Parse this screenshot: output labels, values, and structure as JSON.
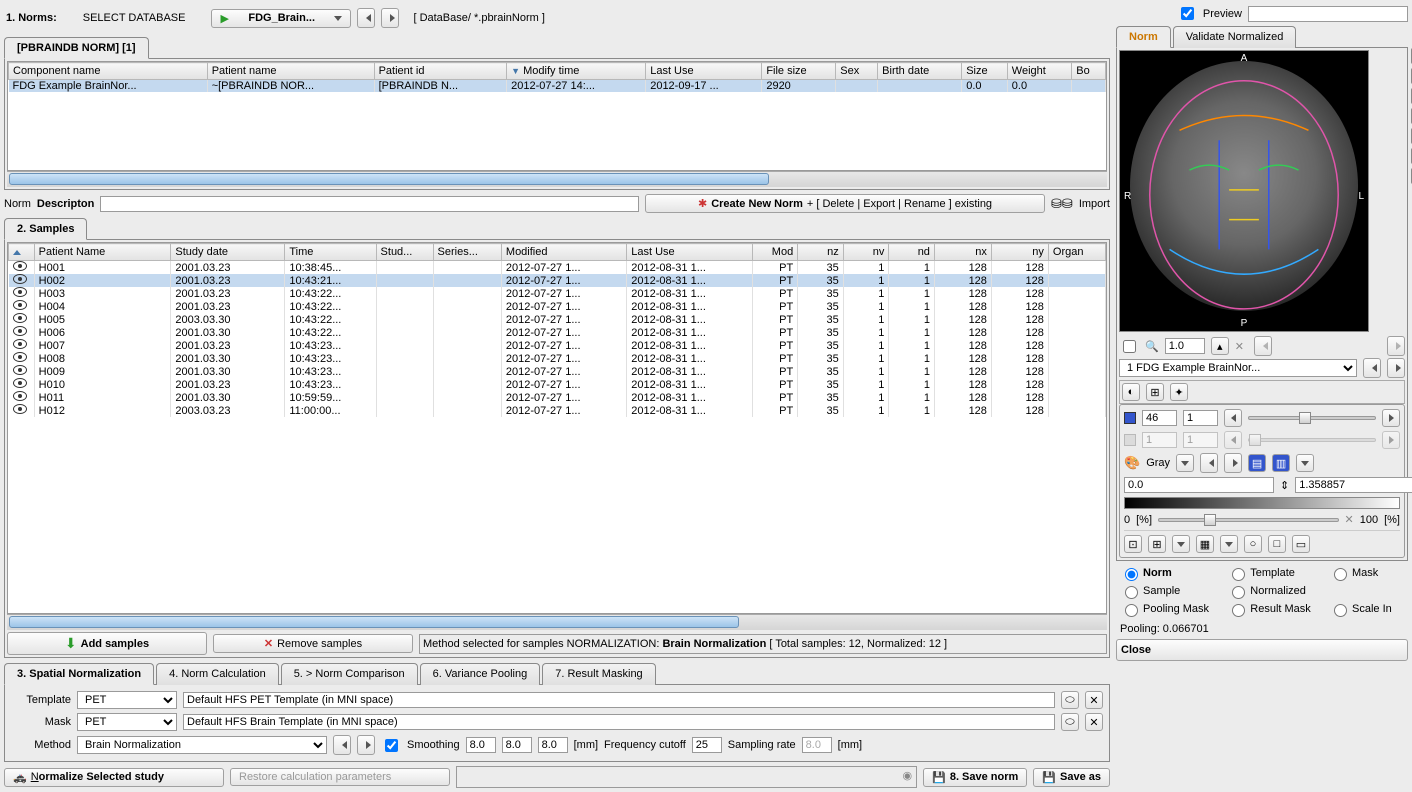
{
  "top": {
    "title": "1. Norms:",
    "selectDb": "SELECT DATABASE",
    "dbDropdown": "FDG_Brain...",
    "dbPath": "[  DataBase/ *.pbrainNorm  ]"
  },
  "normTable": {
    "tab": "[PBRAINDB NORM] [1]",
    "headers": [
      "Component name",
      "Patient name",
      "Patient id",
      "Modify time",
      "Last Use",
      "File size",
      "Sex",
      "Birth date",
      "Size",
      "Weight",
      "Bo"
    ],
    "row": [
      "FDG Example BrainNor...",
      "~[PBRAINDB NOR...",
      "[PBRAINDB N...",
      "2012-07-27 14:...",
      "2012-09-17 ...",
      "2920",
      "",
      "",
      "0.0",
      "0.0",
      ""
    ]
  },
  "normDesc": {
    "label": "Norm Descripton",
    "createBtn": "Create New Norm",
    "createSuffix": "+ [ Delete | Export | Rename ] existing",
    "importLabel": "Import"
  },
  "samplesTab": "2. Samples",
  "samplesTable": {
    "headers": [
      "Patient Name",
      "Study date",
      "Time",
      "Stud...",
      "Series...",
      "Modified",
      "Last Use",
      "Mod",
      "nz",
      "nv",
      "nd",
      "nx",
      "ny",
      "Organ"
    ],
    "rows": [
      {
        "name": "H001",
        "date": "2001.03.23",
        "time": "10:38:45...",
        "mod": "2012-07-27 1...",
        "last": "2012-08-31 1...",
        "modality": "PT",
        "nz": "35",
        "nv": "1",
        "nd": "1",
        "nx": "128",
        "ny": "128"
      },
      {
        "name": "H002",
        "date": "2001.03.23",
        "time": "10:43:21...",
        "mod": "2012-07-27 1...",
        "last": "2012-08-31 1...",
        "modality": "PT",
        "nz": "35",
        "nv": "1",
        "nd": "1",
        "nx": "128",
        "ny": "128",
        "selected": true
      },
      {
        "name": "H003",
        "date": "2001.03.23",
        "time": "10:43:22...",
        "mod": "2012-07-27 1...",
        "last": "2012-08-31 1...",
        "modality": "PT",
        "nz": "35",
        "nv": "1",
        "nd": "1",
        "nx": "128",
        "ny": "128"
      },
      {
        "name": "H004",
        "date": "2001.03.23",
        "time": "10:43:22...",
        "mod": "2012-07-27 1...",
        "last": "2012-08-31 1...",
        "modality": "PT",
        "nz": "35",
        "nv": "1",
        "nd": "1",
        "nx": "128",
        "ny": "128"
      },
      {
        "name": "H005",
        "date": "2003.03.30",
        "time": "10:43:22...",
        "mod": "2012-07-27 1...",
        "last": "2012-08-31 1...",
        "modality": "PT",
        "nz": "35",
        "nv": "1",
        "nd": "1",
        "nx": "128",
        "ny": "128"
      },
      {
        "name": "H006",
        "date": "2001.03.30",
        "time": "10:43:22...",
        "mod": "2012-07-27 1...",
        "last": "2012-08-31 1...",
        "modality": "PT",
        "nz": "35",
        "nv": "1",
        "nd": "1",
        "nx": "128",
        "ny": "128"
      },
      {
        "name": "H007",
        "date": "2001.03.23",
        "time": "10:43:23...",
        "mod": "2012-07-27 1...",
        "last": "2012-08-31 1...",
        "modality": "PT",
        "nz": "35",
        "nv": "1",
        "nd": "1",
        "nx": "128",
        "ny": "128"
      },
      {
        "name": "H008",
        "date": "2001.03.30",
        "time": "10:43:23...",
        "mod": "2012-07-27 1...",
        "last": "2012-08-31 1...",
        "modality": "PT",
        "nz": "35",
        "nv": "1",
        "nd": "1",
        "nx": "128",
        "ny": "128"
      },
      {
        "name": "H009",
        "date": "2001.03.30",
        "time": "10:43:23...",
        "mod": "2012-07-27 1...",
        "last": "2012-08-31 1...",
        "modality": "PT",
        "nz": "35",
        "nv": "1",
        "nd": "1",
        "nx": "128",
        "ny": "128"
      },
      {
        "name": "H010",
        "date": "2001.03.23",
        "time": "10:43:23...",
        "mod": "2012-07-27 1...",
        "last": "2012-08-31 1...",
        "modality": "PT",
        "nz": "35",
        "nv": "1",
        "nd": "1",
        "nx": "128",
        "ny": "128"
      },
      {
        "name": "H011",
        "date": "2001.03.30",
        "time": "10:59:59...",
        "mod": "2012-07-27 1...",
        "last": "2012-08-31 1...",
        "modality": "PT",
        "nz": "35",
        "nv": "1",
        "nd": "1",
        "nx": "128",
        "ny": "128"
      },
      {
        "name": "H012",
        "date": "2003.03.23",
        "time": "11:00:00...",
        "mod": "2012-07-27 1...",
        "last": "2012-08-31 1...",
        "modality": "PT",
        "nz": "35",
        "nv": "1",
        "nd": "1",
        "nx": "128",
        "ny": "128"
      }
    ]
  },
  "samplesFooter": {
    "addBtn": "Add samples",
    "removeBtn": "Remove samples",
    "methodText": "Method selected for samples NORMALIZATION: ",
    "methodBold": "Brain Normalization",
    "stats": " [ Total samples: 12, Normalized: 12 ]"
  },
  "procTabs": [
    "3. Spatial Normalization",
    "4. Norm Calculation",
    "5. > Norm Comparison",
    "6. Variance Pooling",
    "7. Result Masking"
  ],
  "spatial": {
    "templateLabel": "Template",
    "templateVal": "PET",
    "templateDesc": "Default HFS PET Template (in MNI space)",
    "maskLabel": "Mask",
    "maskVal": "PET",
    "maskDesc": "Default HFS Brain Template (in MNI space)",
    "methodLabel": "Method",
    "methodVal": "Brain Normalization",
    "smoothing": "Smoothing",
    "sm1": "8.0",
    "sm2": "8.0",
    "sm3": "8.0",
    "mm1": "[mm]",
    "freqLabel": "Frequency cutoff",
    "freqVal": "25",
    "sampLabel": "Sampling rate",
    "sampVal": "8.0",
    "mm2": "[mm]"
  },
  "bottomBar": {
    "normBtn": "Normalize Selected study",
    "normAccel": "N",
    "restoreBtn": "Restore calculation parameters",
    "saveNorm": "8. Save norm",
    "saveAs": "Save as"
  },
  "rightPanel": {
    "previewChk": "Preview",
    "tab1": "Norm",
    "tab2": "Validate Normalized",
    "dirA": "A",
    "dirP": "P",
    "dirR": "R",
    "dirL": "L",
    "zoomVal": "1.0",
    "seriesDrop": "1 FDG Example BrainNor...",
    "rangeA": "46",
    "rangeB": "1",
    "rangeC": "1",
    "rangeD": "1",
    "cmLabel": "Gray",
    "minVal": "0.0",
    "maxVal": "1.358857",
    "pct0": "0",
    "pct100": "100",
    "pctLabel": "[%]",
    "radios": [
      "Norm",
      "Template",
      "Mask",
      "Sample",
      "Normalized",
      "",
      "Pooling Mask",
      "Result Mask",
      "Scale In"
    ],
    "pooling": "Pooling: 0.066701",
    "closeBtn": "Close"
  }
}
